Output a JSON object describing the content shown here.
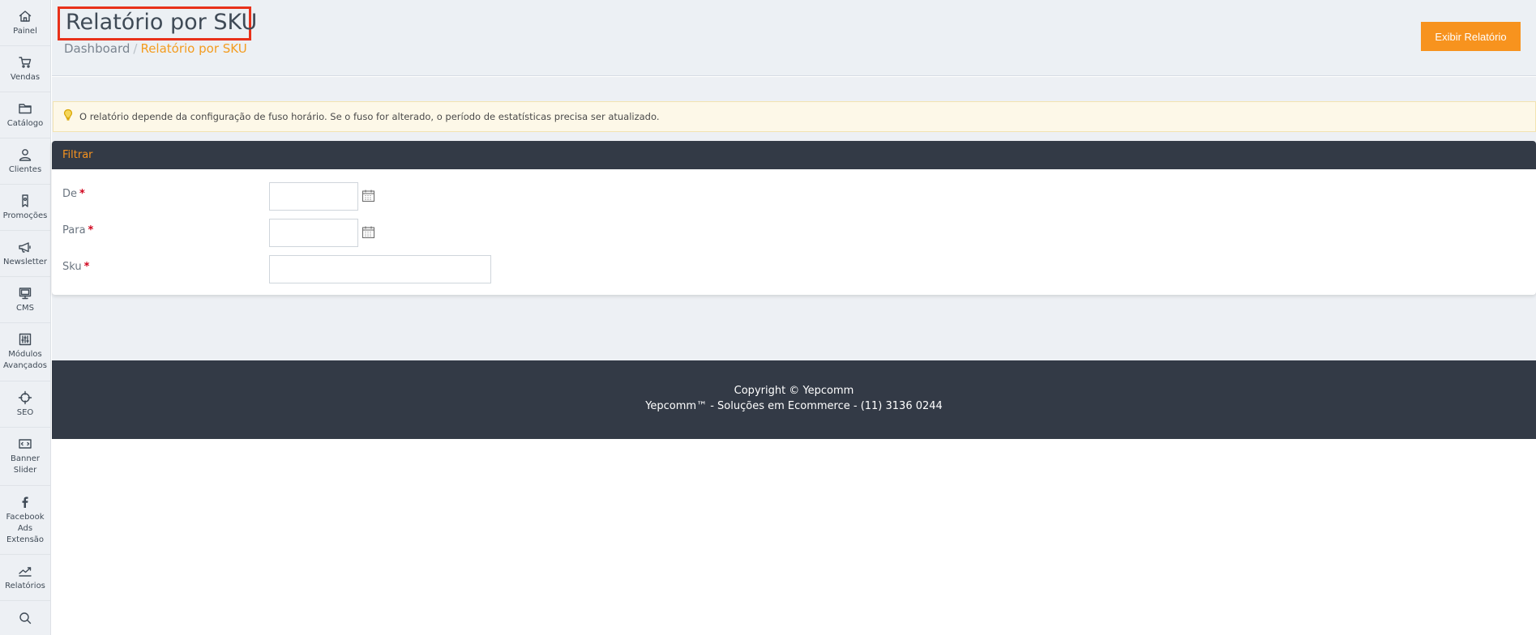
{
  "sidebar": {
    "items": [
      {
        "label": "Painel",
        "icon": "home-icon"
      },
      {
        "label": "Vendas",
        "icon": "cart-icon"
      },
      {
        "label": "Catálogo",
        "icon": "folder-icon"
      },
      {
        "label": "Clientes",
        "icon": "user-icon"
      },
      {
        "label": "Promoções",
        "icon": "tag-icon"
      },
      {
        "label": "Newsletter",
        "icon": "megaphone-icon"
      },
      {
        "label": "CMS",
        "icon": "monitor-icon"
      },
      {
        "label": "Módulos\nAvançados",
        "icon": "sliders-icon"
      },
      {
        "label": "SEO",
        "icon": "crosshair-icon"
      },
      {
        "label": "Banner\nSlider",
        "icon": "slider-icon"
      },
      {
        "label": "Facebook\nAds\nExtensão",
        "icon": "facebook-icon"
      },
      {
        "label": "Relatórios",
        "icon": "trend-icon"
      },
      {
        "label": "",
        "icon": "search-icon"
      }
    ]
  },
  "header": {
    "title": "Relatório por SKU",
    "breadcrumb": {
      "home": "Dashboard",
      "separator": "/",
      "current": "Relatório por SKU"
    },
    "action_button": "Exibir Relatório"
  },
  "notice": {
    "text": "O relatório depende da configuração de fuso horário. Se o fuso for alterado, o período de estatísticas precisa ser atualizado."
  },
  "filter": {
    "title": "Filtrar",
    "fields": [
      {
        "label": "De",
        "required_mark": "*",
        "value": ""
      },
      {
        "label": "Para",
        "required_mark": "*",
        "value": ""
      },
      {
        "label": "Sku",
        "required_mark": "*",
        "value": ""
      }
    ]
  },
  "footer": {
    "line1": "Copyright © Yepcomm",
    "line2": "Yepcomm™ - Soluções em Ecommerce - (11) 3136 0244"
  },
  "colors": {
    "accent": "#f7931e",
    "dark": "#333a46",
    "highlight_border": "#e8311a"
  }
}
